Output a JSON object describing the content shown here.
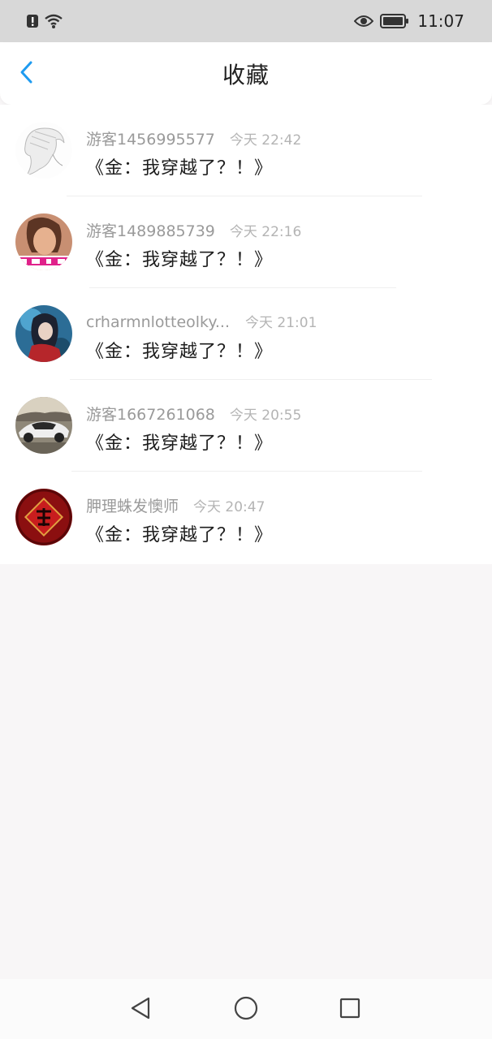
{
  "status_bar": {
    "time": "11:07",
    "icons": [
      "alert-icon",
      "wifi-icon",
      "eye-icon",
      "battery-icon"
    ]
  },
  "header": {
    "title": "收藏",
    "back_icon": "chevron-left-icon",
    "accent_color": "#1f9bf0"
  },
  "favorites": [
    {
      "user": "游客1456995577",
      "time": "今天 22:42",
      "title": "《金：我穿越了？！》",
      "avatar": "sketch-portrait"
    },
    {
      "user": "游客1489885739",
      "time": "今天 22:16",
      "title": "《金：我穿越了？！》",
      "avatar": "woman-photo"
    },
    {
      "user": "crharmnlotteolky...",
      "time": "今天 21:01",
      "title": "《金：我穿越了？！》",
      "avatar": "anime-character"
    },
    {
      "user": "游客1667261068",
      "time": "今天 20:55",
      "title": "《金：我穿越了？！》",
      "avatar": "white-sports-car"
    },
    {
      "user": "胛理蛛发懊师",
      "time": "今天 20:47",
      "title": "《金：我穿越了？！》",
      "avatar": "red-fu-charm"
    }
  ],
  "system_nav": {
    "icons": [
      "back-triangle-icon",
      "home-circle-icon",
      "recents-square-icon"
    ]
  }
}
